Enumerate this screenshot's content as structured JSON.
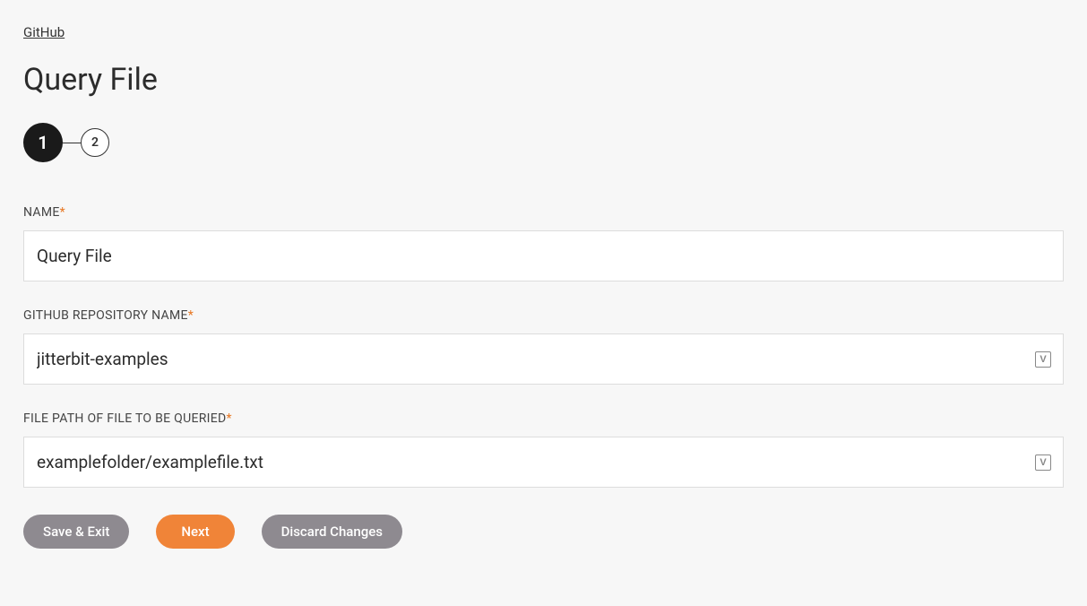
{
  "breadcrumb": {
    "link_text": "GitHub"
  },
  "page": {
    "title": "Query File"
  },
  "stepper": {
    "step1": "1",
    "step2": "2"
  },
  "fields": {
    "name": {
      "label": "NAME",
      "value": "Query File"
    },
    "repo": {
      "label": "GITHUB REPOSITORY NAME",
      "value": "jitterbit-examples"
    },
    "filepath": {
      "label": "FILE PATH OF FILE TO BE QUERIED",
      "value": "examplefolder/examplefile.txt"
    }
  },
  "buttons": {
    "save_exit": "Save & Exit",
    "next": "Next",
    "discard": "Discard Changes"
  },
  "required_marker": "*"
}
